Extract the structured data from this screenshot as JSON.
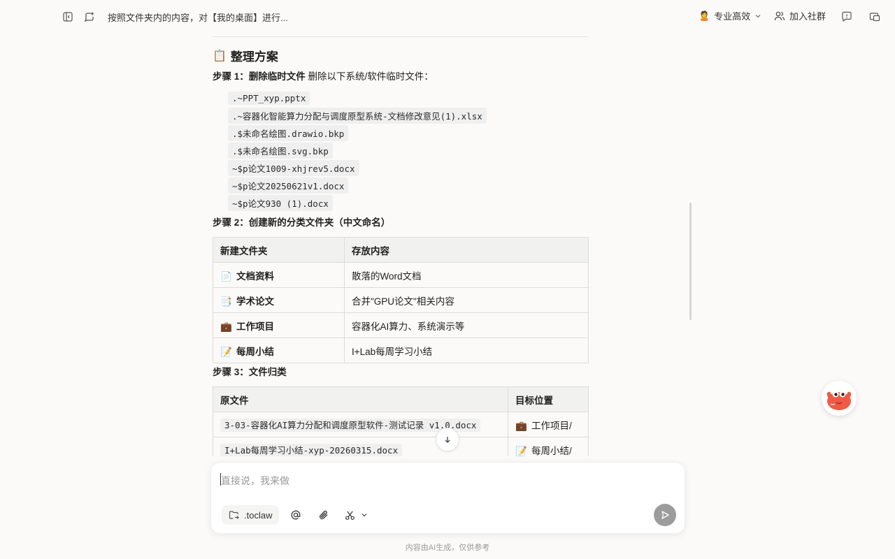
{
  "header": {
    "title": "按照文件夹内的内容，对【我的桌面】进行...",
    "mode_label": "专业高效",
    "community_label": "加入社群"
  },
  "content": {
    "section_title": "整理方案",
    "step1_label": "步骤 1：删除临时文件",
    "step1_desc": " 删除以下系统/软件临时文件：",
    "temp_files": [
      ".~PPT_xyp.pptx",
      ".~容器化智能算力分配与调度原型系统-文档修改意见(1).xlsx",
      ".$未命名绘图.drawio.bkp",
      ".$未命名绘图.svg.bkp",
      "~$p论文1009-xhjrev5.docx",
      "~$p论文20250621v1.docx",
      "~$p论文930 (1).docx"
    ],
    "step2_label": "步骤 2：创建新的分类文件夹（中文命名）",
    "folders_table": {
      "headers": [
        "新建文件夹",
        "存放内容"
      ],
      "rows": [
        {
          "icon": "📄",
          "name": "文档资料",
          "content": "散落的Word文档"
        },
        {
          "icon": "📑",
          "name": "学术论文",
          "content": "合并\"GPU论文\"相关内容"
        },
        {
          "icon": "💼",
          "name": "工作项目",
          "content": "容器化AI算力、系统演示等"
        },
        {
          "icon": "📝",
          "name": "每周小结",
          "content": "I+Lab每周学习小结"
        }
      ]
    },
    "step3_label": "步骤 3：文件归类",
    "classify_table": {
      "headers": [
        "原文件",
        "目标位置"
      ],
      "rows": [
        {
          "file": "3-03-容器化AI算力分配和调度原型软件-测试记录 v1.0.docx",
          "icon": "💼",
          "target": "工作项目/"
        },
        {
          "file": "I+Lab每周学习小结-xyp-20260315.docx",
          "icon": "📝",
          "target": "每周小结/"
        }
      ]
    }
  },
  "input": {
    "placeholder": "直接说，我来做",
    "chip_label": ".toclaw"
  },
  "footer": {
    "note": "内容由AI生成，仅供参考"
  }
}
